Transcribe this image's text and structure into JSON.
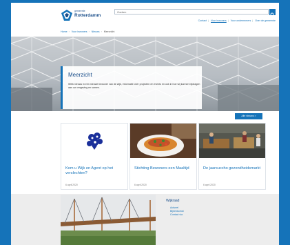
{
  "header": {
    "logo_small": "gemeente",
    "logo_big": "Rotterdamm",
    "search_placeholder": "Zoeken",
    "top_links": [
      "Contact",
      "Voor inwoners",
      "Voor ondernemers",
      "Over de gemeente"
    ],
    "active_top_link_index": 1
  },
  "breadcrumb": [
    "Home",
    "Voor inwoners",
    "Nieuws",
    "Meerzicht"
  ],
  "hero": {
    "title": "Meerzicht",
    "text": "Welk nieuws in een nieuwe bewoner van de wijk, informatie over projecten en events en ook in hoe wij kunnen bijdragen aan uw omgeving en samen."
  },
  "news": {
    "all_news_label": "Alle nieuws >",
    "cards": [
      {
        "title": "Kom u Wijk en Agent op het verslechten?",
        "date": "6 april 2020"
      },
      {
        "title": "Stichting Bewoners een Maaltijd",
        "date": "6 april 2020"
      },
      {
        "title": "De jaarsuccho gezondheidsmarkt",
        "date": "6 april 2020"
      }
    ]
  },
  "footer": {
    "title": "Wijkraad",
    "links": [
      "Actueel",
      "Bijeenkomst",
      "Contact via"
    ]
  },
  "colors": {
    "brand_blue": "#1573b9",
    "dark_blue": "#1a4e8a",
    "footer_grey": "#ededed"
  },
  "icons": [
    "logo-emblem-icon",
    "search-icon",
    "heart-cluster-icon"
  ]
}
